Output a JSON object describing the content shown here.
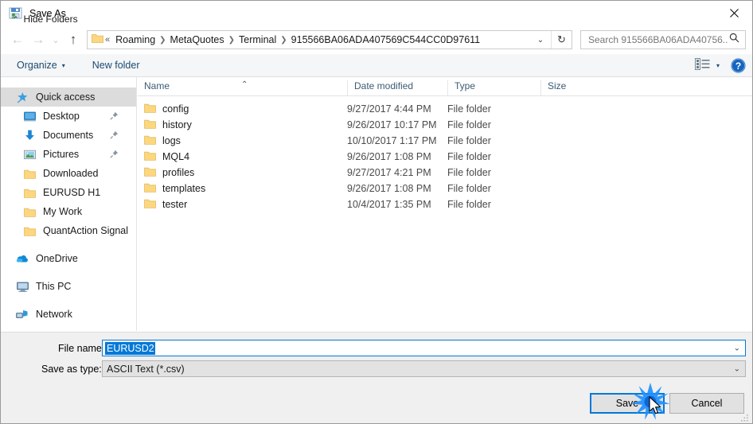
{
  "window": {
    "title": "Save As",
    "icon": "save-as-icon",
    "close_label": "✕"
  },
  "nav": {
    "back": "←",
    "forward": "→",
    "recent": "⌄",
    "up": "↑",
    "breadcrumbs": [
      "Roaming",
      "MetaQuotes",
      "Terminal",
      "915566BA06ADA407569C544CC0D97611"
    ],
    "leading_sep": "«",
    "separator": "❯",
    "dropdown": "⌄",
    "refresh": "↻"
  },
  "search": {
    "placeholder": "Search 915566BA06ADA40756...",
    "value": "",
    "icon": "search-icon"
  },
  "toolbar": {
    "organize_label": "Organize",
    "organize_caret": "▾",
    "new_folder_label": "New folder",
    "view_caret": "▾",
    "help_label": "?"
  },
  "sidebar": {
    "groups": [
      {
        "items": [
          {
            "label": "Quick access",
            "icon": "star-pin-icon",
            "selected": true,
            "pinned": false,
            "indent": 0
          },
          {
            "label": "Desktop",
            "icon": "desktop-icon",
            "selected": false,
            "pinned": true,
            "indent": 1
          },
          {
            "label": "Documents",
            "icon": "documents-icon",
            "selected": false,
            "pinned": true,
            "indent": 1
          },
          {
            "label": "Pictures",
            "icon": "pictures-icon",
            "selected": false,
            "pinned": true,
            "indent": 1
          },
          {
            "label": "Downloaded",
            "icon": "folder-icon",
            "selected": false,
            "pinned": false,
            "indent": 1
          },
          {
            "label": "EURUSD H1",
            "icon": "folder-icon",
            "selected": false,
            "pinned": false,
            "indent": 1
          },
          {
            "label": "My Work",
            "icon": "folder-icon",
            "selected": false,
            "pinned": false,
            "indent": 1
          },
          {
            "label": "QuantAction Signal",
            "icon": "folder-icon",
            "selected": false,
            "pinned": false,
            "indent": 1
          }
        ]
      },
      {
        "items": [
          {
            "label": "OneDrive",
            "icon": "onedrive-icon",
            "selected": false,
            "pinned": false,
            "indent": 0
          }
        ]
      },
      {
        "items": [
          {
            "label": "This PC",
            "icon": "this-pc-icon",
            "selected": false,
            "pinned": false,
            "indent": 0
          }
        ]
      },
      {
        "items": [
          {
            "label": "Network",
            "icon": "network-icon",
            "selected": false,
            "pinned": false,
            "indent": 0
          }
        ]
      }
    ]
  },
  "filelist": {
    "sort_indicator": "⌃",
    "columns": [
      {
        "key": "name",
        "label": "Name"
      },
      {
        "key": "date",
        "label": "Date modified"
      },
      {
        "key": "type",
        "label": "Type"
      },
      {
        "key": "size",
        "label": "Size"
      }
    ],
    "rows": [
      {
        "name": "config",
        "date": "9/27/2017 4:44 PM",
        "type": "File folder",
        "size": ""
      },
      {
        "name": "history",
        "date": "9/26/2017 10:17 PM",
        "type": "File folder",
        "size": ""
      },
      {
        "name": "logs",
        "date": "10/10/2017 1:17 PM",
        "type": "File folder",
        "size": ""
      },
      {
        "name": "MQL4",
        "date": "9/26/2017 1:08 PM",
        "type": "File folder",
        "size": ""
      },
      {
        "name": "profiles",
        "date": "9/27/2017 4:21 PM",
        "type": "File folder",
        "size": ""
      },
      {
        "name": "templates",
        "date": "9/26/2017 1:08 PM",
        "type": "File folder",
        "size": ""
      },
      {
        "name": "tester",
        "date": "10/4/2017 1:35 PM",
        "type": "File folder",
        "size": ""
      }
    ]
  },
  "form": {
    "filename_label": "File name:",
    "filename_value": "EURUSD2",
    "filename_arrow": "⌄",
    "savetype_label": "Save as type:",
    "savetype_value": "ASCII Text (*.csv)",
    "savetype_arrow": "⌄"
  },
  "footer": {
    "hide_folders_label": "Hide Folders",
    "hide_folders_caret": "⌃",
    "save_label": "Save",
    "cancel_label": "Cancel"
  },
  "colors": {
    "accent": "#0078d7",
    "folder": "#fcd77f",
    "selection": "#dcdcdc",
    "header_text": "#3d5a73",
    "toolbar_text": "#1b4a73",
    "chrome_bg": "#f0f0f0"
  }
}
